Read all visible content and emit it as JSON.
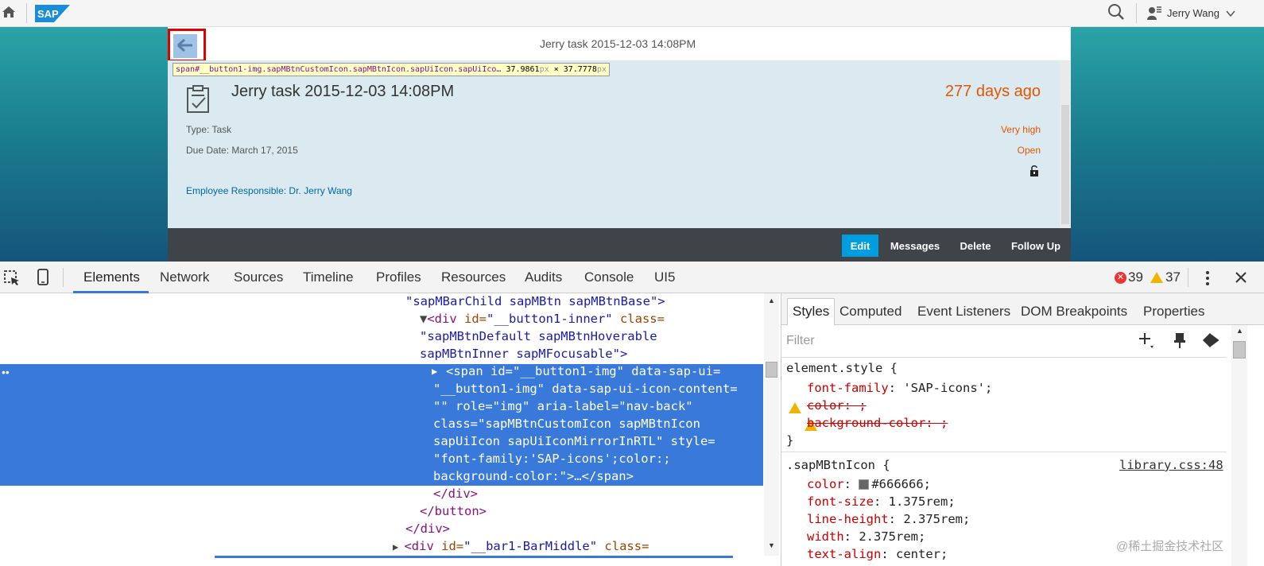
{
  "shell": {
    "brand": "SAP",
    "user_name": "Jerry Wang"
  },
  "app": {
    "nav_title": "Jerry task 2015-12-03 14:08PM",
    "tooltip": {
      "selector": "span#__button1-img.sapMBtnCustomIcon.sapMBtnIcon.sapUiIcon.sapUiIco…",
      "w": "37.9861",
      "h": "37.7778",
      "unit": "px",
      "x": " × "
    },
    "header": {
      "title": "Jerry task 2015-12-03 14:08PM",
      "number": "277 days ago",
      "attr1": "Type: Task",
      "attr2": "Due Date: March 17, 2015",
      "attr3": "Employee Responsible: Dr. Jerry Wang",
      "status1": "Very high",
      "status2": "Open"
    },
    "footer": {
      "edit": "Edit",
      "messages": "Messages",
      "delete": "Delete",
      "follow_up": "Follow Up"
    },
    "colors": {
      "accent": "#009de0",
      "number": "#e35500",
      "link": "#00679e"
    }
  },
  "devtools": {
    "tabs": [
      "Elements",
      "Network",
      "Sources",
      "Timeline",
      "Profiles",
      "Resources",
      "Audits",
      "Console",
      "UI5"
    ],
    "errors": "39",
    "warnings": "37",
    "dom": {
      "l1": "\"sapMBarChild sapMBtn sapMBtnBase\">",
      "l2_tag": "<div",
      "l2_attr": " id=",
      "l2_val": "\"__button1-inner\"",
      "l2_attr2": " class=",
      "l3": "\"sapMBtnDefault sapMBtnHoverable",
      "l4": "sapMBtnInner sapMFocusable\">",
      "s1": "<span id=\"__button1-img\" data-sap-ui=",
      "s2": "\"__button1-img\" data-sap-ui-icon-content=",
      "s3": "\"\" role=\"img\" aria-label=\"nav-back\"",
      "s4": "class=\"sapMBtnCustomIcon sapMBtnIcon",
      "s5": "sapUiIcon sapUiIconMirrorInRTL\" style=",
      "s6": "\"font-family:'SAP-icons';color:;",
      "s7": "background-color:\">…</span>",
      "c1": "</div>",
      "c2": "</button>",
      "c3": "</div>",
      "l_last_tag": "<div",
      "l_last_attr": " id=",
      "l_last_val": "\"__bar1-BarMiddle\"",
      "l_last_attr2": " class="
    },
    "styles": {
      "tabs": [
        "Styles",
        "Computed",
        "Event Listeners",
        "DOM Breakpoints",
        "Properties"
      ],
      "filter_placeholder": "Filter",
      "element_style": "element.style {",
      "p1_name": "font-family",
      "p1_val": "'SAP-icons';",
      "p2": "color: ;",
      "p3": "background-color: ;",
      "close": "}",
      "rule2_sel": ".sapMBtnIcon {",
      "rule2_src": "library.css:48",
      "r1_name": "color",
      "r1_val": "#666666;",
      "r2_name": "font-size",
      "r2_val": "1.375rem;",
      "r3_name": "line-height",
      "r3_val": "2.375rem;",
      "r4_name": "width",
      "r4_val": "2.375rem;",
      "r5_name": "text-align",
      "r5_val": "center;"
    },
    "watermark": "@稀土掘金技术社区"
  }
}
